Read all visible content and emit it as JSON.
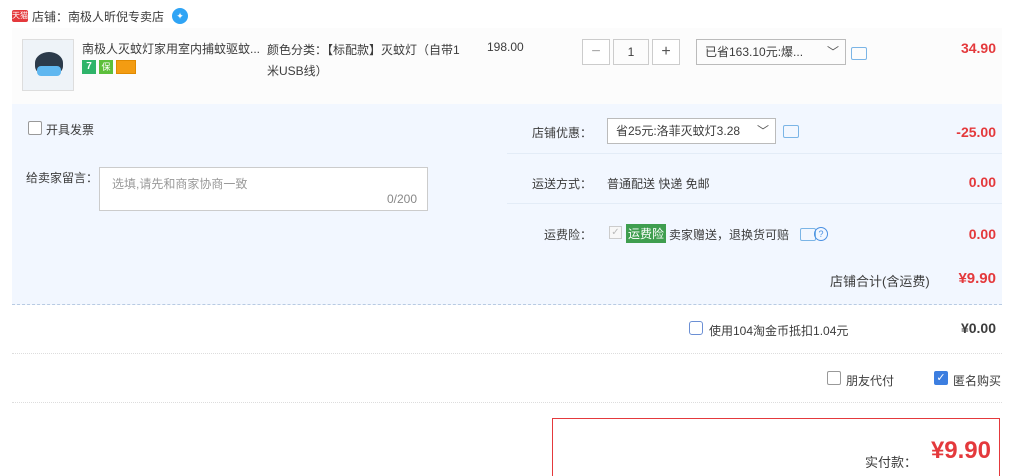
{
  "shop": {
    "badge": "天猫",
    "name": "店铺：南极人昕倪专卖店",
    "ww_icon": "chat-bubble-icon"
  },
  "item": {
    "title": "南极人灭蚊灯家用室内捕蚊驱蚊...",
    "sku": "颜色分类：【标配款】灭蚊灯（自带1米USB线）",
    "price": "198.00",
    "quantity": "1",
    "minus": "−",
    "plus": "+",
    "promo": "已省163.10元:爆...",
    "total": "34.90"
  },
  "invoice": {
    "label": "开具发票"
  },
  "message": {
    "label": "给卖家留言：",
    "placeholder": "选填,请先和商家协商一致",
    "count": "0/200"
  },
  "coupon": {
    "label": "店铺优惠：",
    "value": "省25元:洛菲灭蚊灯3.28",
    "amount": "-25.00"
  },
  "shipping": {
    "label": "运送方式：",
    "value": "普通配送 快递 免邮",
    "amount": "0.00"
  },
  "insurance": {
    "label": "运费险：",
    "tag": "运费险",
    "desc": "卖家赠送，退换货可赔",
    "amount": "0.00"
  },
  "subtotal": {
    "label": "店铺合计(含运费)",
    "amount": "¥9.90"
  },
  "coins": {
    "label": "使用104淘金币抵扣1.04元",
    "amount": "¥0.00"
  },
  "options": {
    "friend_pay": "朋友代付",
    "anonymous": "匿名购买"
  },
  "pay": {
    "label": "实付款：",
    "amount": "¥9.90"
  },
  "colors": {
    "accent": "#e4393c",
    "panel": "#f2f7ff",
    "link": "#3c7ee0"
  }
}
